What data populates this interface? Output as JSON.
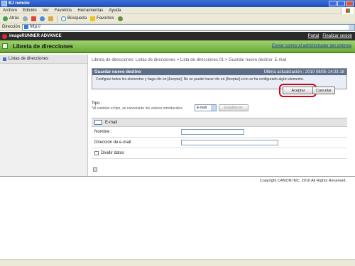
{
  "window": {
    "title": "BJ remoto"
  },
  "menu": [
    "Archivo",
    "Edición",
    "Ver",
    "Favoritos",
    "Herramientas",
    "Ayuda"
  ],
  "toolbar": {
    "back": "Atrás",
    "search": "Búsqueda",
    "favorites": "Favoritos"
  },
  "address": {
    "label": "Dirección",
    "value": "http://"
  },
  "header": {
    "product": "imageRUNNER ADVANCE",
    "links": [
      "Portal",
      "Finalizar sesión"
    ]
  },
  "titleband": {
    "title": "Libreta de direcciones",
    "admin_link": "Enviar correo al administrador del sistema"
  },
  "sidebar": {
    "items": [
      {
        "label": "Listas de direcciones"
      }
    ]
  },
  "breadcrumb": "Libreta de direcciones: Listas de direcciones > Lista de direcciones 01 > Guardar nuevo destino: E-mail",
  "panel": {
    "title": "Guardar nuevo destino",
    "updated": "Última actualización : 2010 08/05 14:03:18",
    "instruction": "Configure todos los elementos y haga clic en [Aceptar]. No se puede hacer clic en [Aceptar] si no se ha configurado algún elemento."
  },
  "buttons": {
    "accept": "Aceptar",
    "cancel": "Cancelar",
    "set": "Establecer"
  },
  "type": {
    "label": "Tipo :",
    "note": "*Al cambiar el tipo, se cancelarán los valores introducidos.",
    "selected": "E-mail"
  },
  "email": {
    "heading": "E-mail",
    "fields": {
      "name": "Nombre :",
      "address": "Dirección de e-mail",
      "split": "Dividir datos"
    }
  },
  "footer": {
    "copyright": "Copyright CANON INC. 2010 All Rights Reserved."
  },
  "colors": {
    "accent_ring": "#d0021b",
    "title_band": "#7cbd48"
  }
}
